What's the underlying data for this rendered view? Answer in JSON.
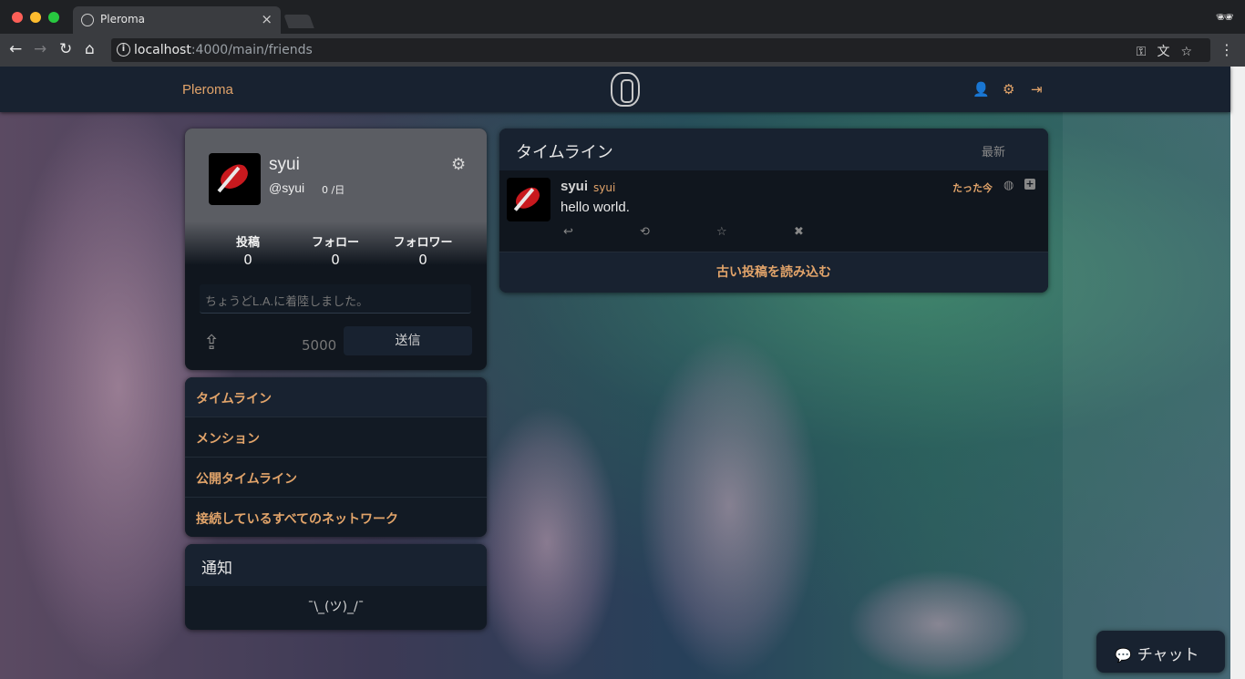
{
  "browser": {
    "tab_title": "Pleroma",
    "tab_close": "×",
    "url_host": "localhost",
    "url_path": ":4000/main/friends",
    "icons": [
      "key-icon",
      "translate-icon",
      "star-icon",
      "menu-icon"
    ]
  },
  "navbar": {
    "brand": "Pleroma",
    "icons": [
      "user-plus-icon",
      "gear-icon",
      "logout-icon"
    ]
  },
  "user_card": {
    "name": "syui",
    "handle": "@syui",
    "rate": "0 /日",
    "stats": [
      {
        "label": "投稿",
        "value": "0"
      },
      {
        "label": "フォロー",
        "value": "0"
      },
      {
        "label": "フォロワー",
        "value": "0"
      }
    ],
    "post_placeholder": "ちょうどL.A.に着陸しました。",
    "char_count": "5000",
    "send_label": "送信"
  },
  "nav": {
    "items": [
      {
        "label": "タイムライン",
        "active": true
      },
      {
        "label": "メンション"
      },
      {
        "label": "公開タイムライン"
      },
      {
        "label": "接続しているすべてのネットワーク"
      }
    ]
  },
  "notifications": {
    "title": "通知",
    "empty": "¯\\_(ツ)_/¯"
  },
  "timeline": {
    "title": "タイムライン",
    "refresh_label": "最新",
    "status": {
      "name": "syui",
      "handle": "syui",
      "time": "たった今",
      "text": "hello world."
    },
    "load_more": "古い投稿を読み込む"
  },
  "chat": {
    "label": "チャット"
  },
  "colors": {
    "accent": "#e2a46a",
    "panel": "#121a24",
    "header": "#182230"
  }
}
